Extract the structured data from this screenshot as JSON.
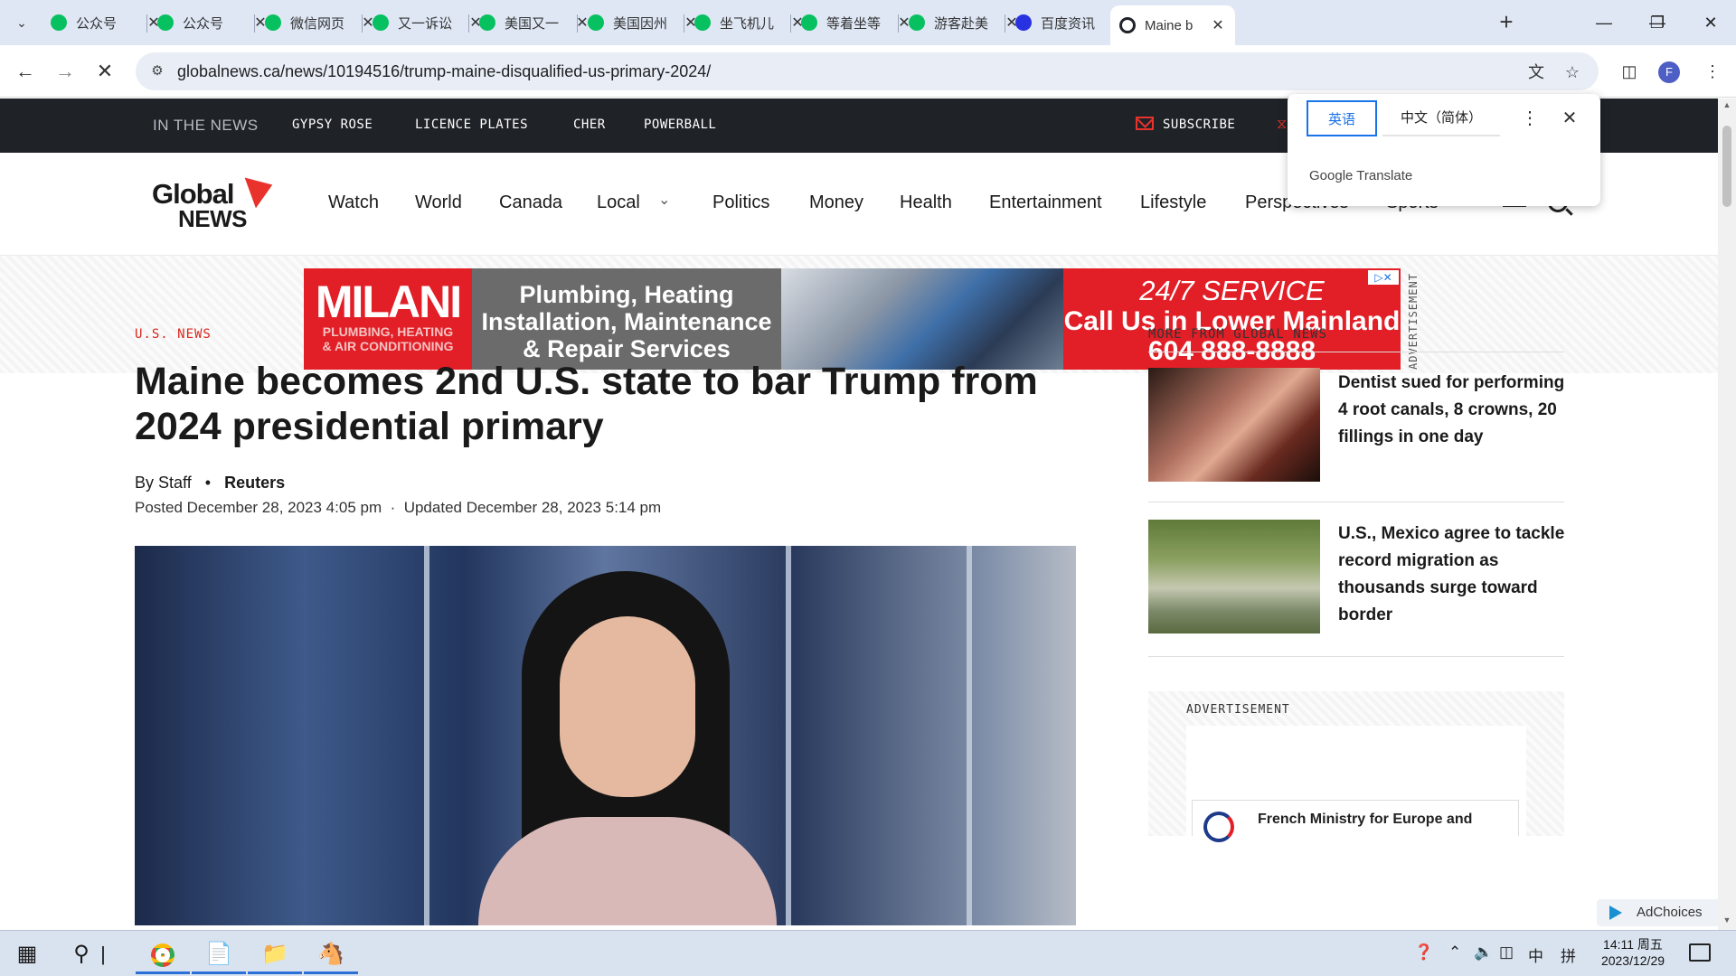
{
  "browser": {
    "tabs": [
      {
        "label": "公众号",
        "color": "#07c160",
        "active": false
      },
      {
        "label": "公众号",
        "color": "#07c160",
        "active": false
      },
      {
        "label": "微信网页",
        "color": "#07c160",
        "active": false
      },
      {
        "label": "又一诉讼",
        "color": "#07c160",
        "active": false
      },
      {
        "label": "美国又一",
        "color": "#07c160",
        "active": false
      },
      {
        "label": "美国因州",
        "color": "#07c160",
        "active": false
      },
      {
        "label": "坐飞机儿",
        "color": "#07c160",
        "active": false
      },
      {
        "label": "等着坐等",
        "color": "#07c160",
        "active": false
      },
      {
        "label": "游客赴美",
        "color": "#07c160",
        "active": false
      },
      {
        "label": "百度资讯",
        "color": "#2932e1",
        "active": false
      },
      {
        "label": "Maine b",
        "color": "#1f2328",
        "active": true
      }
    ],
    "url": "globalnews.ca/news/10194516/trump-maine-disqualified-us-primary-2024/",
    "profile_initial": "F"
  },
  "translate_popup": {
    "source_lang": "英语",
    "target_lang": "中文（简体）",
    "brand_google": "Google",
    "brand_translate": "Translate"
  },
  "site": {
    "in_the_news_label": "IN THE NEWS",
    "trending": [
      "GYPSY ROSE",
      "LICENCE PLATES",
      "CHER",
      "POWERBALL"
    ],
    "subscribe_label": "SUBSCRIBE",
    "logo_line1": "Global",
    "logo_line2": "NEWS",
    "nav": [
      "Watch",
      "World",
      "Canada",
      "Local",
      "Politics",
      "Money",
      "Health",
      "Entertainment",
      "Lifestyle",
      "Perspectives",
      "Sports"
    ]
  },
  "banner_ad": {
    "brand": "MILANI",
    "brand_sub1": "PLUMBING, HEATING",
    "brand_sub2": "& AIR CONDITIONING",
    "services_line1": "Plumbing, Heating",
    "services_line2": "Installation, Maintenance",
    "services_line3": "& Repair Services",
    "cta_line1": "24/7 SERVICE",
    "cta_line2": "Call Us in Lower Mainland",
    "cta_phone": "604 888-8888",
    "ad_label": "ADVERTISEMENT"
  },
  "article": {
    "section": "U.S. NEWS",
    "headline": "Maine becomes 2nd U.S. state to bar Trump from 2024 presidential primary",
    "by_prefix": "By",
    "author": "Staff",
    "source": "Reuters",
    "posted": "Posted December 28, 2023 4:05 pm",
    "updated": "Updated December 28, 2023 5:14 pm"
  },
  "sidebar": {
    "title": "MORE FROM GLOBAL NEWS",
    "items": [
      {
        "title": "Dentist sued for performing 4 root canals, 8 crowns, 20 fillings in one day"
      },
      {
        "title": "U.S., Mexico agree to tackle record migration as thousands surge toward border"
      }
    ],
    "ad_label": "ADVERTISEMENT",
    "ad_text": "French Ministry for Europe and",
    "adchoices_label": "AdChoices"
  },
  "taskbar": {
    "time": "14:11 周五",
    "date": "2023/12/29",
    "ime": "中",
    "ime2": "拼"
  }
}
